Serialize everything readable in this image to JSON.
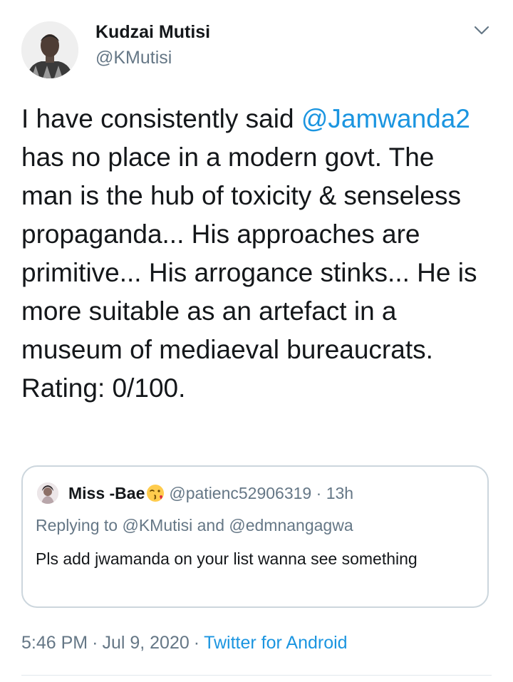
{
  "author": {
    "display_name": "Kudzai Mutisi",
    "handle": "@KMutisi"
  },
  "tweet": {
    "text_before": "I have consistently said ",
    "mention": "@Jamwanda2",
    "text_after": " has no place in a modern govt. The man is the hub of toxicity & senseless propaganda... His approaches are primitive... His arrogance stinks... He is more suitable as an artefact in a museum of mediaeval bureaucrats. Rating: 0/100."
  },
  "quoted": {
    "display_name": "Miss -Bae",
    "emoji": "kissing-face-icon",
    "handle": "@patienc52906319",
    "dot": "·",
    "time": "13h",
    "replying_prefix": "Replying to ",
    "replying_user1": "@KMutisi",
    "replying_and": " and ",
    "replying_user2": "@edmnangagwa",
    "text": "Pls add jwamanda on your list wanna see something"
  },
  "meta": {
    "time": "5:46 PM",
    "dot1": "·",
    "date": "Jul 9, 2020",
    "dot2": "·",
    "source": "Twitter for Android"
  },
  "colors": {
    "link": "#1b95e0",
    "secondary_text": "#657786",
    "primary_text": "#14171a",
    "border": "#ccd6dd"
  }
}
